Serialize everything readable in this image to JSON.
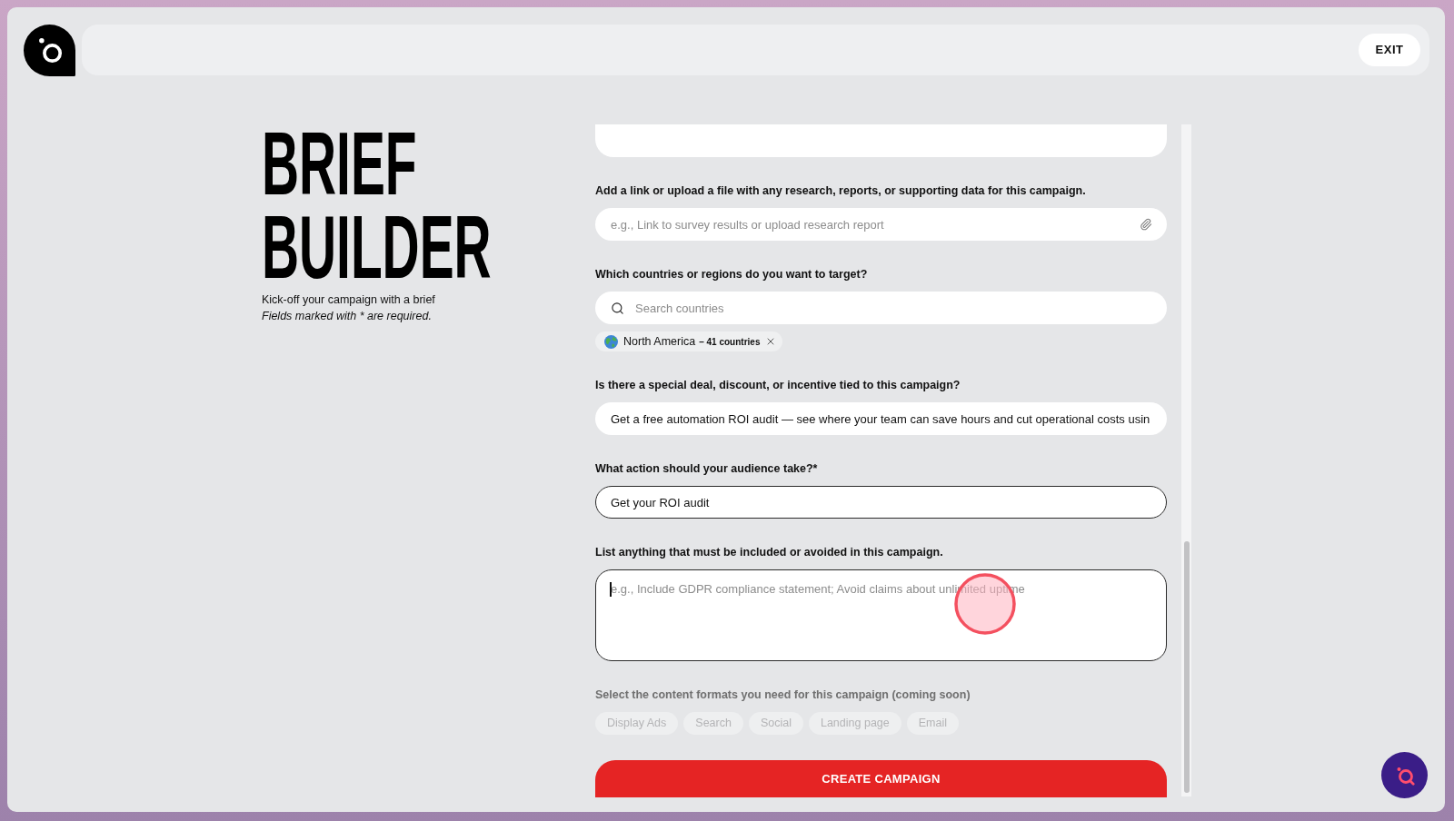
{
  "header": {
    "exit_button": "EXIT"
  },
  "intro": {
    "title": "BRIEF BUILDER",
    "subtitle": "Kick-off your campaign with a brief",
    "note": "Fields marked with * are required."
  },
  "form": {
    "fields": [
      {
        "kind": "clipped",
        "outlined": false,
        "focused": false
      },
      {
        "kind": "attach",
        "label": "Add a link or upload a file with any research, reports, or supporting data for this campaign.",
        "placeholder": "e.g., Link to survey results or upload research report",
        "outlined": false,
        "focused": false
      },
      {
        "kind": "search",
        "label": "Which countries or regions do you want to target?",
        "placeholder": "Search countries",
        "outlined": false,
        "focused": false,
        "chips": [
          {
            "label": "North America",
            "count": "– 41 countries"
          }
        ]
      },
      {
        "kind": "text",
        "label": "Is there a special deal, discount, or incentive tied to this campaign?",
        "value": "Get a free automation ROI audit — see where your team can save hours and cut operational costs usin",
        "outlined": false,
        "focused": false
      },
      {
        "kind": "text",
        "label": "What action should your audience take?*",
        "value": "Get your ROI audit",
        "outlined": true,
        "focused": false
      },
      {
        "kind": "textarea",
        "label": "List anything that must be included or avoided in this campaign.",
        "placeholder": "e.g., Include GDPR compliance statement; Avoid claims about unlimited uptime",
        "outlined": true,
        "focused": true
      },
      {
        "kind": "options",
        "label": "Select the content formats you need for this campaign (coming soon)",
        "disabled": true,
        "options": [
          {
            "label": "Display Ads",
            "selected": false,
            "disabled": true
          },
          {
            "label": "Search",
            "selected": false,
            "disabled": true
          },
          {
            "label": "Social",
            "selected": false,
            "disabled": true
          },
          {
            "label": "Landing page",
            "selected": false,
            "disabled": true
          },
          {
            "label": "Email",
            "selected": false,
            "disabled": true
          }
        ]
      }
    ],
    "submit_button": "CREATE CAMPAIGN"
  }
}
